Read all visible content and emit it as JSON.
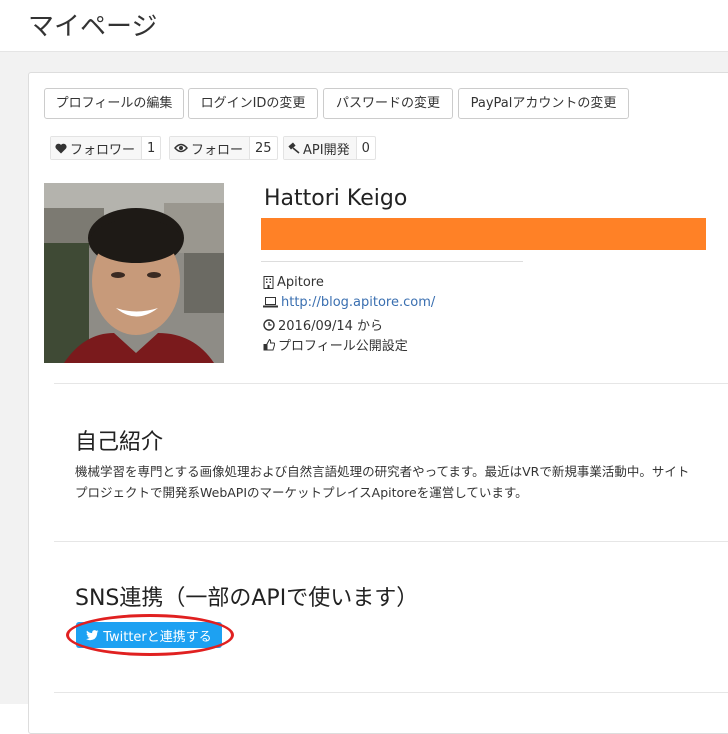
{
  "header": {
    "title": "マイページ"
  },
  "toolbar": {
    "edit_profile": "プロフィールの編集",
    "change_login": "ログインIDの変更",
    "change_password": "パスワードの変更",
    "change_paypal": "PayPalアカウントの変更"
  },
  "stats": {
    "followers_label": "フォロワー",
    "followers_count": "1",
    "following_label": "フォロー",
    "following_count": "25",
    "api_label": "API開発",
    "api_count": "0"
  },
  "profile": {
    "name": "Hattori Keigo",
    "company": "Apitore",
    "website": "http://blog.apitore.com/",
    "since": "2016/09/14 から",
    "visibility": "プロフィール公開設定",
    "highlight_color": "#ff8126"
  },
  "bio": {
    "heading": "自己紹介",
    "line1": "機械学習を専門とする画像処理および自然言語処理の研究者やってます。最近はVRで新規事業活動中。サイト",
    "line2": "プロジェクトで開発系WebAPIのマーケットプレイスApitoreを運営しています。"
  },
  "sns": {
    "heading": "SNS連携（一部のAPIで使います）",
    "twitter_button": "Twitterと連携する",
    "twitter_color": "#1da1f2",
    "annotation_color": "#e02020"
  }
}
